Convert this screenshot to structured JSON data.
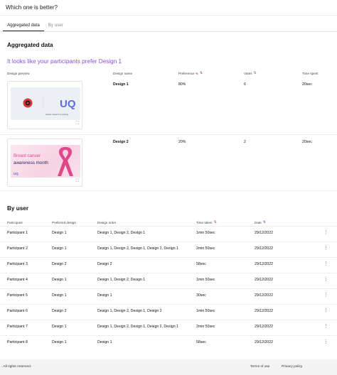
{
  "header": {
    "title": "Which one is better?"
  },
  "tabs": [
    {
      "label": "Aggregated data",
      "active": true
    },
    {
      "label": "By user",
      "active": false
    }
  ],
  "aggregated": {
    "title": "Aggregated data",
    "headline": "It looks like your participants prefer Design 1",
    "columns": [
      "Design preview",
      "Design name",
      "Preference %",
      "Votes",
      "Time spent"
    ],
    "rows": [
      {
        "name": "Design 1",
        "preference": "80%",
        "votes": "6",
        "time": "20sec",
        "preview": {
          "logo": "UQ",
          "caption": "Cancer research is evolving"
        }
      },
      {
        "name": "Design 2",
        "preference": "20%",
        "votes": "2",
        "time": "20sec",
        "preview": {
          "line1": "Breast cancer",
          "line2": "awareness month",
          "logo": "UQ"
        }
      }
    ]
  },
  "by_user": {
    "title": "By user",
    "columns": [
      "Participant",
      "Preferred design",
      "Design order",
      "Time taken",
      "Date"
    ],
    "rows": [
      {
        "participant": "Participant 1",
        "preferred": "Design 1",
        "order": "Design 1, Design 2, Design 1",
        "time": "1min 50sec",
        "date": "29/12/2022"
      },
      {
        "participant": "Participant 2",
        "preferred": "Design 1",
        "order": "Design 1, Design 2, Design 1, Design 2, Design 1",
        "time": "2min 50sec",
        "date": "29/12/2022"
      },
      {
        "participant": "Participant 3",
        "preferred": "Design 2",
        "order": "Design 2",
        "time": "58sec",
        "date": "29/12/2022"
      },
      {
        "participant": "Participant 4",
        "preferred": "Design 1",
        "order": "Design 1, Design 2, Design 1",
        "time": "1min 50sec",
        "date": "29/12/2022"
      },
      {
        "participant": "Participant 5",
        "preferred": "Design 1",
        "order": "Design 1",
        "time": "30sec",
        "date": "29/12/2022"
      },
      {
        "participant": "Participant 6",
        "preferred": "Design 2",
        "order": "Design 1, Design 2, Design 1, Design 2",
        "time": "1min 50sec",
        "date": "29/12/2022"
      },
      {
        "participant": "Participant 7",
        "preferred": "Design 1",
        "order": "Design 1, Design 2, Design 1, Design 2, Design 1",
        "time": "2min 50sec",
        "date": "29/12/2022"
      },
      {
        "participant": "Participant 8",
        "preferred": "Design 1",
        "order": "Design 1",
        "time": "58sec",
        "date": "29/12/2022"
      }
    ]
  },
  "footer": {
    "copyright": ". All rights reserved.",
    "terms": "Terms of use",
    "privacy": "Privacy policy"
  },
  "colors": {
    "accent": "#8a4fcf",
    "sort": "#a23bd6",
    "ribbon": "#e0468a"
  },
  "icons": {
    "sort": "sort-icon",
    "expand": "expand-icon",
    "more": "more-vertical-icon"
  }
}
